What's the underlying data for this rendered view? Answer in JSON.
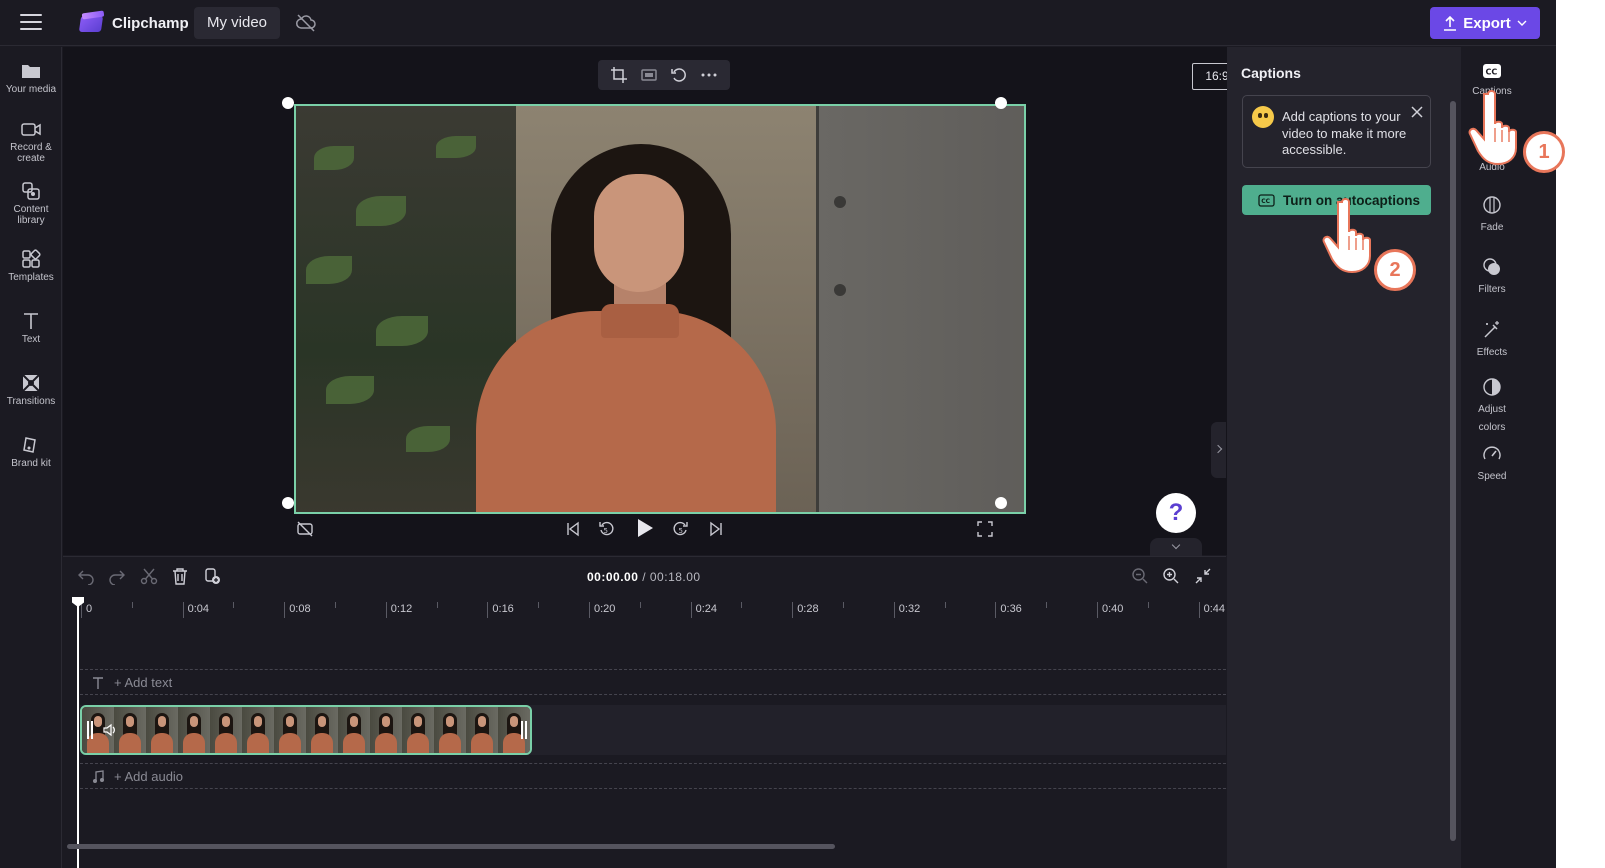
{
  "app": {
    "name": "Clipchamp",
    "project_name": "My video",
    "export_label": "Export"
  },
  "left_sidebar": {
    "items": [
      {
        "label": "Your media",
        "icon": "folder-icon"
      },
      {
        "label": "Record &\ncreate",
        "icon": "camera-icon"
      },
      {
        "label": "Content\nlibrary",
        "icon": "library-icon"
      },
      {
        "label": "Templates",
        "icon": "templates-icon"
      },
      {
        "label": "Text",
        "icon": "text-icon"
      },
      {
        "label": "Transitions",
        "icon": "transitions-icon"
      },
      {
        "label": "Brand kit",
        "icon": "brand-kit-icon"
      }
    ]
  },
  "preview": {
    "aspect_ratio": "16:9",
    "toolbar_icons": [
      "crop-icon",
      "fit-icon",
      "rotate-icon",
      "more-icon"
    ],
    "help_label": "?"
  },
  "timeline": {
    "current_time": "00:00.00",
    "total_time": "/ 00:18.00",
    "ruler_labels": [
      "0",
      "0:04",
      "0:08",
      "0:12",
      "0:16",
      "0:20",
      "0:24",
      "0:28",
      "0:32",
      "0:36",
      "0:40",
      "0:44"
    ],
    "add_text_label": "+ Add text",
    "add_audio_label": "+ Add audio"
  },
  "captions_panel": {
    "title": "Captions",
    "info_message": "Add captions to your video to make it more accessible.",
    "button_label": "Turn on autocaptions"
  },
  "right_rail": {
    "items": [
      {
        "label": "Captions",
        "icon": "cc-icon"
      },
      {
        "label": "Audio",
        "icon": "audio-icon"
      },
      {
        "label": "Fade",
        "icon": "fade-icon"
      },
      {
        "label": "Filters",
        "icon": "filters-icon"
      },
      {
        "label": "Effects",
        "icon": "effects-icon"
      },
      {
        "label": "Adjust\ncolors",
        "icon": "adjust-colors-icon"
      },
      {
        "label": "Speed",
        "icon": "speed-icon"
      }
    ]
  },
  "steps": {
    "step1": "1",
    "step2": "2"
  },
  "colors": {
    "accent": "#6b48e6",
    "autocaptions_button": "#4fae8e",
    "selection": "#7ad0a8",
    "step_badge": "#e8765a"
  }
}
